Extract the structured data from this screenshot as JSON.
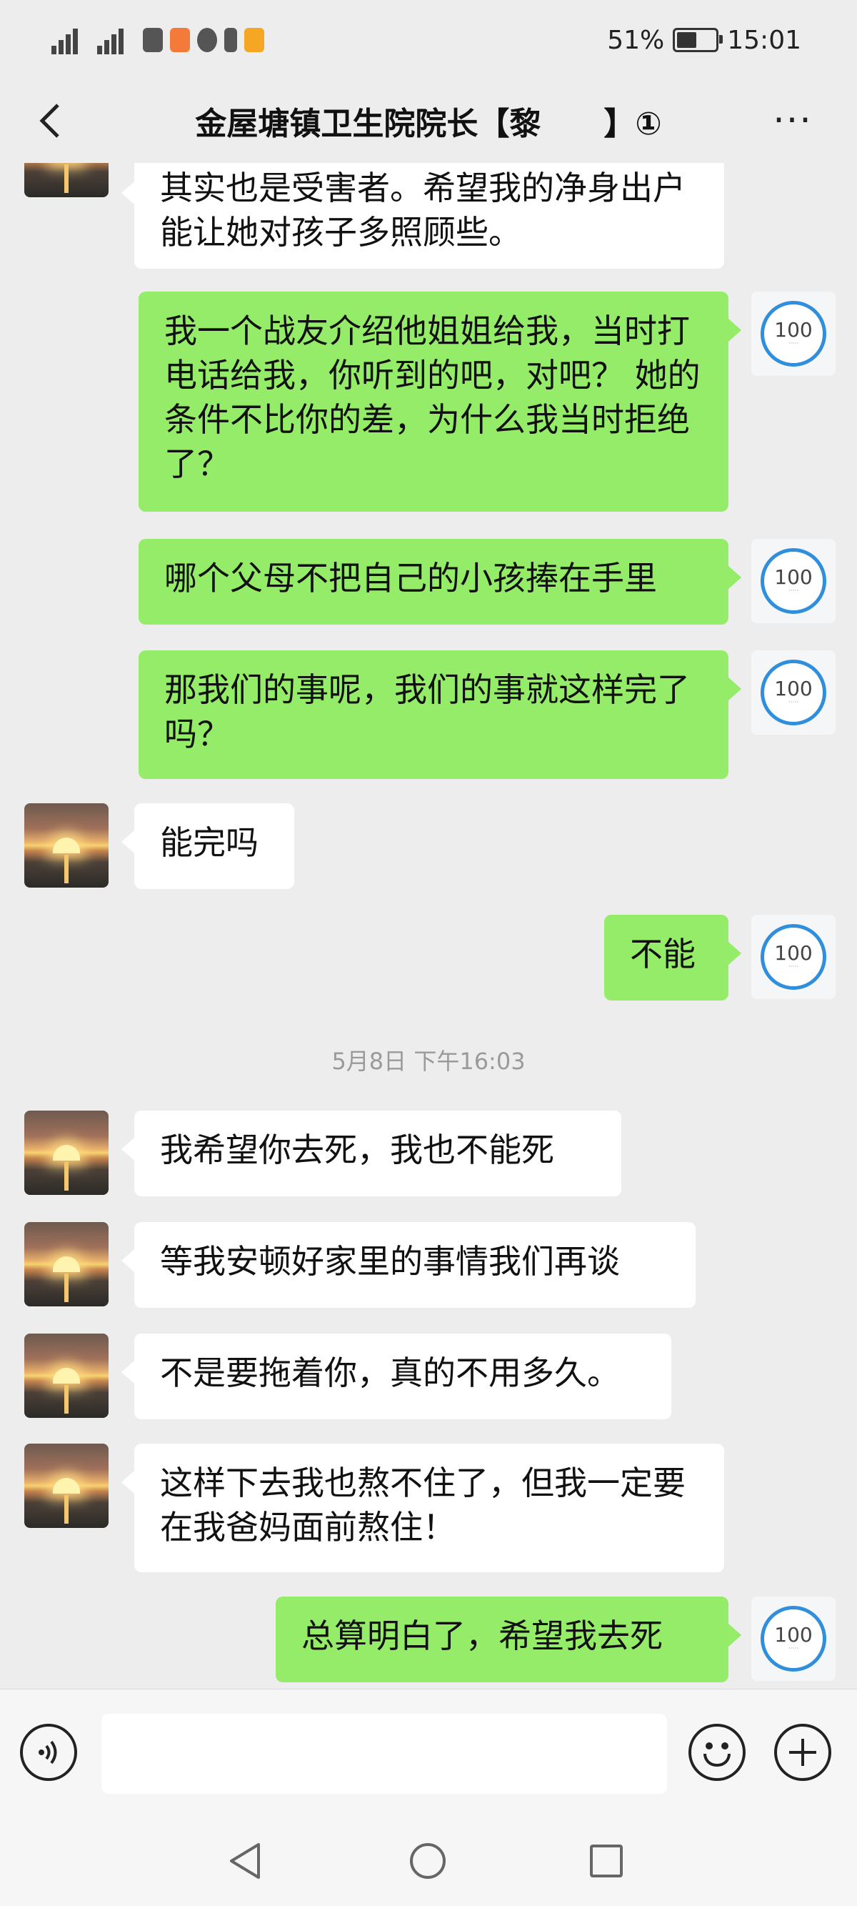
{
  "status_bar": {
    "left_icons": [
      "hd-signal-icon-1",
      "4g-signal-icon",
      "4g-signal-icon-2",
      "wifi-icon",
      "video-app-icon",
      "message-app-icon",
      "sim-icon",
      "notification-app-icon"
    ],
    "battery_percent": "51%",
    "time": "15:01"
  },
  "header": {
    "title": "金屋塘镇卫生院院长【黎　　】①",
    "more": "···"
  },
  "messages": [
    {
      "from": "them",
      "text": "其实也是受害者。希望我的净身出户能让她对孩子多照顾些。"
    },
    {
      "from": "me",
      "text": " 我一个战友介绍他姐姐给我，当时打电话给我，你听到的吧，对吧？ 她的条件不比你的差，为什么我当时拒绝了？"
    },
    {
      "from": "me",
      "text": "哪个父母不把自己的小孩捧在手里"
    },
    {
      "from": "me",
      "text": "那我们的事呢，我们的事就这样完了吗？"
    },
    {
      "from": "them",
      "text": "能完吗"
    },
    {
      "from": "me",
      "text": "不能"
    },
    {
      "from": "them",
      "text": "我希望你去死，我也不能死"
    },
    {
      "from": "them",
      "text": "等我安顿好家里的事情我们再谈"
    },
    {
      "from": "them",
      "text": "不是要拖着你，真的不用多久。"
    },
    {
      "from": "them",
      "text": "这样下去我也熬不住了，但我一定要在我爸妈面前熬住！"
    },
    {
      "from": "me",
      "text": "总算明白了，希望我去死"
    }
  ],
  "timestamp": "5月8日 下午16:03",
  "my_avatar_badge": "100",
  "input": {
    "value": "",
    "placeholder": ""
  },
  "colors": {
    "background": "#ededed",
    "my_bubble": "#95ec69",
    "their_bubble": "#ffffff",
    "avatar_ring": "#2f8fdd"
  }
}
